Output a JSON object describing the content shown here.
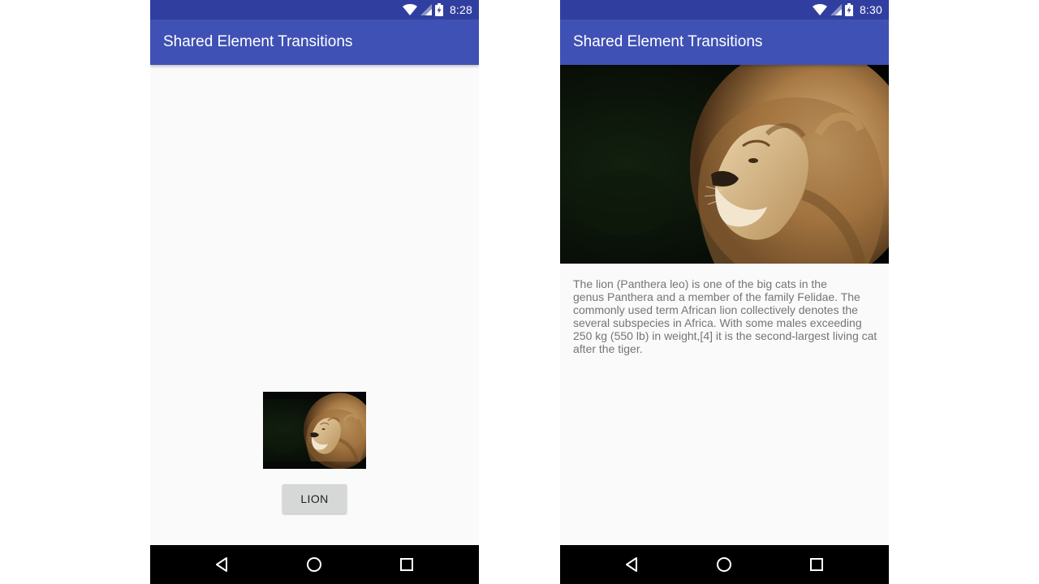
{
  "screens": [
    {
      "status_bar": {
        "time": "8:28"
      },
      "app_bar": {
        "title": "Shared Element Transitions"
      },
      "content": {
        "thumbnail": {
          "subject": "lion"
        },
        "button": {
          "label": "LION"
        }
      }
    },
    {
      "status_bar": {
        "time": "8:30"
      },
      "app_bar": {
        "title": "Shared Element Transitions"
      },
      "content": {
        "hero_image": {
          "subject": "lion"
        },
        "description_lines": [
          "The lion (Panthera leo) is one of the big cats in the",
          "genus Panthera and a member of the family Felidae. The",
          "commonly used term African lion collectively denotes the",
          "several subspecies in Africa. With some males exceeding",
          "250 kg (550 lb) in weight,[4] it is the second-largest living cat",
          "after the tiger."
        ]
      }
    }
  ],
  "icons": {
    "status": [
      "wifi-icon",
      "cell-signal-icon",
      "battery-charging-icon"
    ],
    "navigation": [
      "back-icon",
      "home-icon",
      "recents-icon"
    ]
  },
  "colors": {
    "status_bar": "#303f9f",
    "app_bar": "#3f51b5",
    "screen_background": "#fafafa",
    "button": "#d6d7d7",
    "nav_bar": "#000000",
    "body_text": "#757575"
  }
}
